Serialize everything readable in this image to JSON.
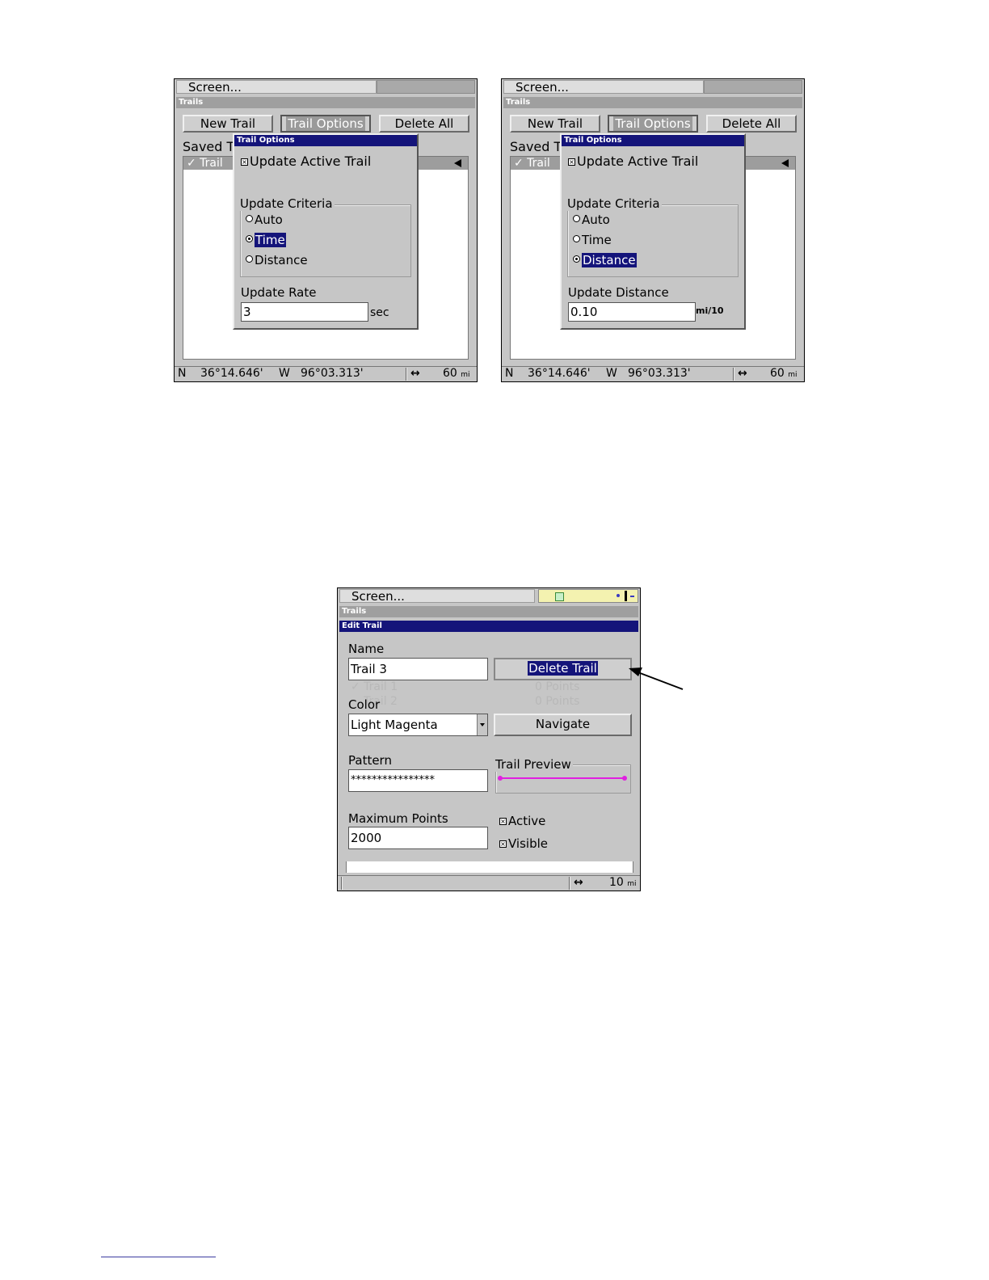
{
  "screen1": {
    "menu": "Screen...",
    "title": "Trails",
    "buttons": [
      "New Trail",
      "Trail Options",
      "Delete All"
    ],
    "saved_partial": "Saved T",
    "list_item": "✓ Trail",
    "dialog_title": "Trail Options",
    "update_active": "Update Active Trail",
    "criteria_label": "Update Criteria",
    "opt_auto": "Auto",
    "opt_time": "Time",
    "opt_distance": "Distance",
    "selected": "Time",
    "rate_label": "Update Rate",
    "rate_value": "3",
    "rate_unit": "sec",
    "lat_dir": "N",
    "lat": "36°14.646'",
    "lon_dir": "W",
    "lon": "96°03.313'",
    "scale_icon": "↔",
    "scale": "60",
    "scale_unit": "mi"
  },
  "screen2": {
    "menu": "Screen...",
    "title": "Trails",
    "buttons": [
      "New Trail",
      "Trail Options",
      "Delete All"
    ],
    "saved_partial": "Saved T",
    "list_item": "✓ Trail",
    "dialog_title": "Trail Options",
    "update_active": "Update Active Trail",
    "criteria_label": "Update Criteria",
    "opt_auto": "Auto",
    "opt_time": "Time",
    "opt_distance": "Distance",
    "selected": "Distance",
    "dist_label": "Update Distance",
    "dist_value": "0.10",
    "dist_unit": "mi/10",
    "lat_dir": "N",
    "lat": "36°14.646'",
    "lon_dir": "W",
    "lon": "96°03.313'",
    "scale_icon": "↔",
    "scale": "60",
    "scale_unit": "mi"
  },
  "screen3": {
    "menu": "Screen...",
    "title": "Trails",
    "dialog_title": "Edit Trail",
    "name_label": "Name",
    "name_value": "Trail 3",
    "delete_button": "Delete Trail",
    "color_label": "Color",
    "color_value": "Light Magenta",
    "navigate_button": "Navigate",
    "pattern_label": "Pattern",
    "pattern_value": "****************",
    "preview_label": "Trail Preview",
    "max_label": "Maximum Points",
    "max_value": "2000",
    "active_label": "Active",
    "visible_label": "Visible",
    "ghost_trail1": "✓ Trail 1",
    "ghost_trail2": "Trail 2",
    "ghost_points1": "0 Points",
    "ghost_points2": "0 Points",
    "scale_icon": "↔",
    "scale": "10",
    "scale_unit": "mi",
    "preview_color": "#e020e0"
  }
}
